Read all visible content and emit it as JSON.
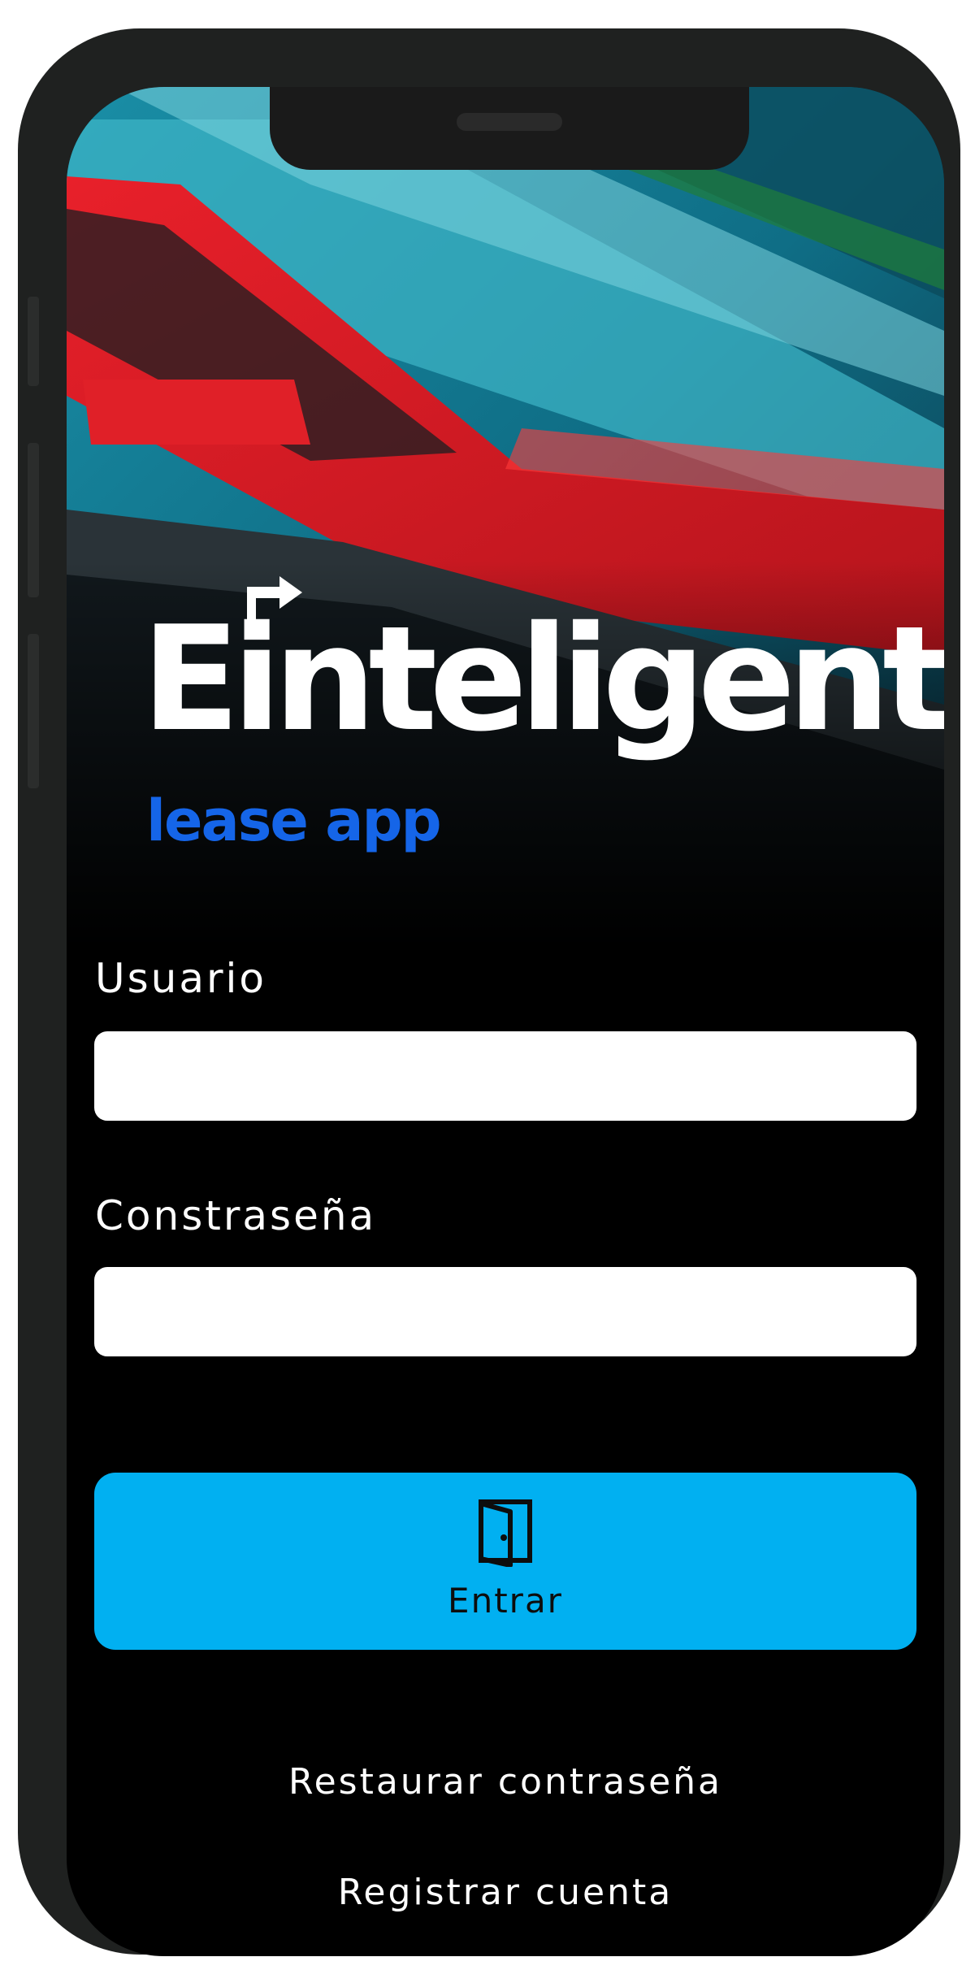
{
  "brand": {
    "name": "Einteligent",
    "tagline": "lease app",
    "colors": {
      "wordmark": "#ffffff",
      "tagline": "#1565e8"
    }
  },
  "hero": {
    "image": "parked-cars-photo"
  },
  "form": {
    "username_label": "Usuario",
    "username_value": "",
    "password_label": "Constraseña",
    "password_value": ""
  },
  "actions": {
    "enter_label": "Entrar",
    "enter_icon": "door-enter-icon",
    "enter_color": "#01b0f1",
    "restore_label": "Restaurar contraseña",
    "register_label": "Registrar cuenta"
  }
}
